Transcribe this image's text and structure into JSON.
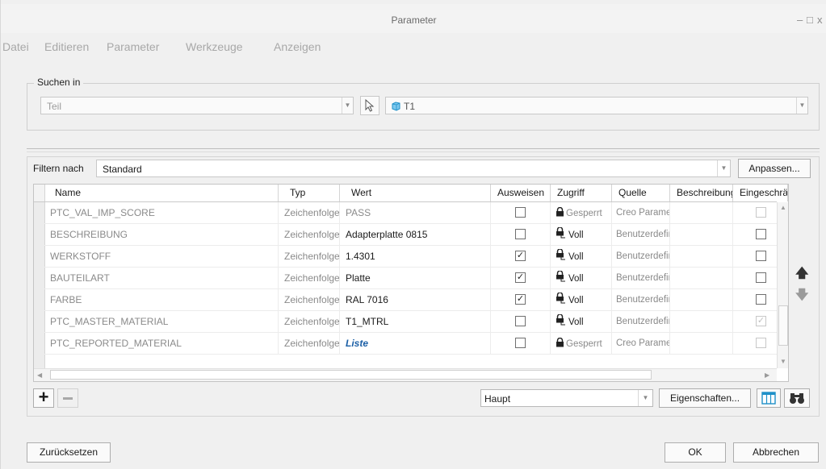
{
  "window": {
    "title": "Parameter",
    "minimize": "–",
    "maximize": "□",
    "close": "x"
  },
  "menu": [
    "Datei",
    "Editieren",
    "Parameter",
    "Werkzeuge",
    "Anzeigen"
  ],
  "search_in": {
    "legend": "Suchen in",
    "scope": "Teil",
    "item": "T1"
  },
  "filter": {
    "label": "Filtern nach",
    "value": "Standard",
    "customize_button": "Anpassen..."
  },
  "table": {
    "columns": [
      "Name",
      "Typ",
      "Wert",
      "Ausweisen",
      "Zugriff",
      "Quelle",
      "Beschreibung",
      "Eingeschränkt"
    ],
    "rows": [
      {
        "name": "PTC_VAL_IMP_SCORE",
        "type": "Zeichenfolge",
        "value": "PASS",
        "designate": false,
        "access": "Gesperrt",
        "source": "Creo Parametric",
        "description": "",
        "restricted": false,
        "system": true
      },
      {
        "name": "BESCHREIBUNG",
        "type": "Zeichenfolge",
        "value": "Adapterplatte 0815",
        "designate": false,
        "access": "Voll",
        "source": "Benutzerdefiniert",
        "description": "",
        "restricted": false,
        "system": false
      },
      {
        "name": "WERKSTOFF",
        "type": "Zeichenfolge",
        "value": "1.4301",
        "designate": true,
        "access": "Voll",
        "source": "Benutzerdefiniert",
        "description": "",
        "restricted": false,
        "system": false
      },
      {
        "name": "BAUTEILART",
        "type": "Zeichenfolge",
        "value": "Platte",
        "designate": true,
        "access": "Voll",
        "source": "Benutzerdefiniert",
        "description": "",
        "restricted": false,
        "system": false
      },
      {
        "name": "FARBE",
        "type": "Zeichenfolge",
        "value": "RAL 7016",
        "designate": true,
        "access": "Voll",
        "source": "Benutzerdefiniert",
        "description": "",
        "restricted": false,
        "system": false
      },
      {
        "name": "PTC_MASTER_MATERIAL",
        "type": "Zeichenfolge",
        "value": "T1_MTRL",
        "designate": false,
        "access": "Voll",
        "source": "Benutzerdefiniert",
        "description": "",
        "restricted": true,
        "system": false
      },
      {
        "name": "PTC_REPORTED_MATERIAL",
        "type": "Zeichenfolge",
        "value": "Liste",
        "designate": false,
        "access": "Gesperrt",
        "source": "Creo Parametric",
        "description": "",
        "restricted": false,
        "system": true,
        "value_is_link": true
      }
    ]
  },
  "toolbar": {
    "add_icon": "plus-icon",
    "remove_icon": "minus-icon",
    "view": "Haupt",
    "properties_button": "Eigenschaften...",
    "table_icon": "table-columns-icon",
    "find_icon": "binoculars-icon"
  },
  "footer": {
    "reset_button": "Zurücksetzen",
    "ok_button": "OK",
    "cancel_button": "Abbrechen"
  },
  "colors": {
    "link": "#1b5fa6",
    "accent": "#1e90c8"
  }
}
